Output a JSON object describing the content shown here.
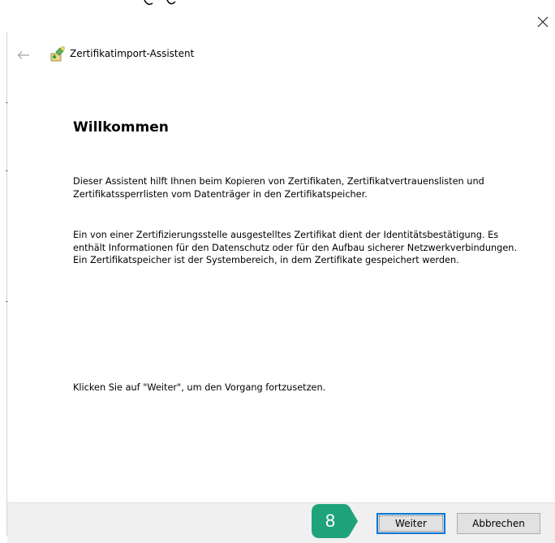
{
  "window": {
    "title": "Zertifikatimport-Assistent",
    "close_icon": "close-icon",
    "back_icon": "back-arrow-icon",
    "wizard_icon": "certificate-wizard-icon"
  },
  "main": {
    "heading": "Willkommen",
    "paragraph_1": "Dieser Assistent hilft Ihnen beim Kopieren von Zertifikaten, Zertifikatvertrauenslisten und Zertifikatssperrlisten vom Datenträger in den Zertifikatspeicher.",
    "paragraph_2": "Ein von einer Zertifizierungsstelle ausgestelltes Zertifikat dient der Identitätsbestätigung. Es enthält Informationen für den Datenschutz oder für den Aufbau sicherer Netzwerkverbindungen. Ein Zertifikatspeicher ist der Systembereich, in dem Zertifikate gespeichert werden.",
    "paragraph_3": "Klicken Sie auf \"Weiter\", um den Vorgang fortzusetzen."
  },
  "footer": {
    "next_label": "Weiter",
    "cancel_label": "Abbrechen"
  },
  "annotation": {
    "step_number": "8",
    "color": "#1fa37a"
  }
}
